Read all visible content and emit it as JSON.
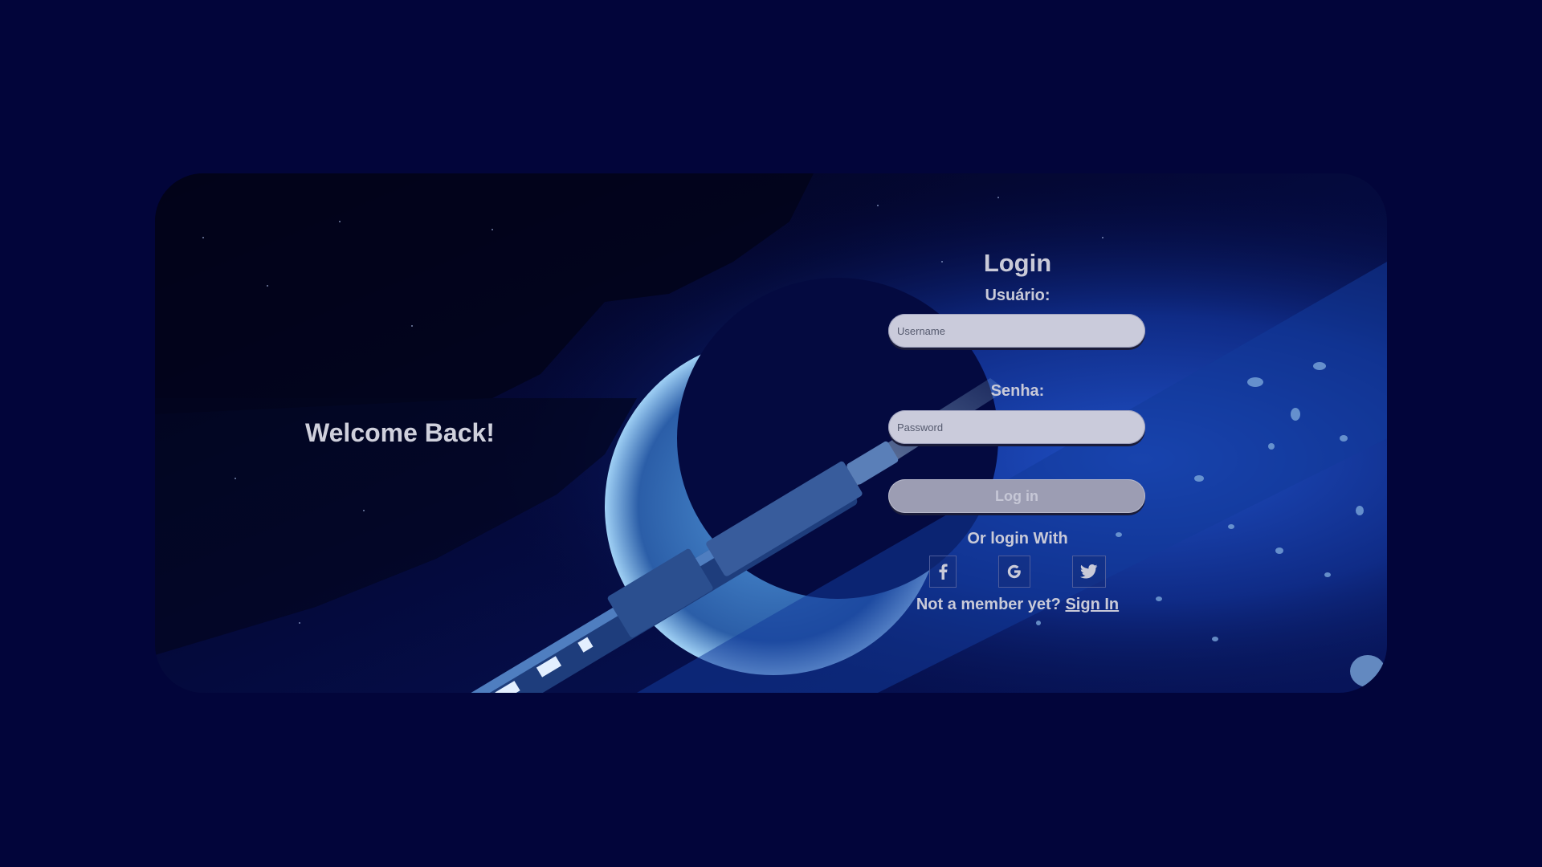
{
  "welcome": {
    "text": "Welcome Back!"
  },
  "login": {
    "title": "Login",
    "username_label": "Usuário:",
    "username_placeholder": "Username",
    "password_label": "Senha:",
    "password_placeholder": "Password",
    "submit_label": "Log in",
    "alt_login_text": "Or login With",
    "social": [
      {
        "name": "facebook-icon"
      },
      {
        "name": "google-icon"
      },
      {
        "name": "twitter-icon"
      }
    ],
    "signup_prompt": "Not a member yet?",
    "signup_link": "Sign In"
  },
  "colors": {
    "page_background": "#02053a",
    "text": "#c9cad8",
    "input_background": "#cacbdb",
    "button_background": "#9c9db3"
  }
}
